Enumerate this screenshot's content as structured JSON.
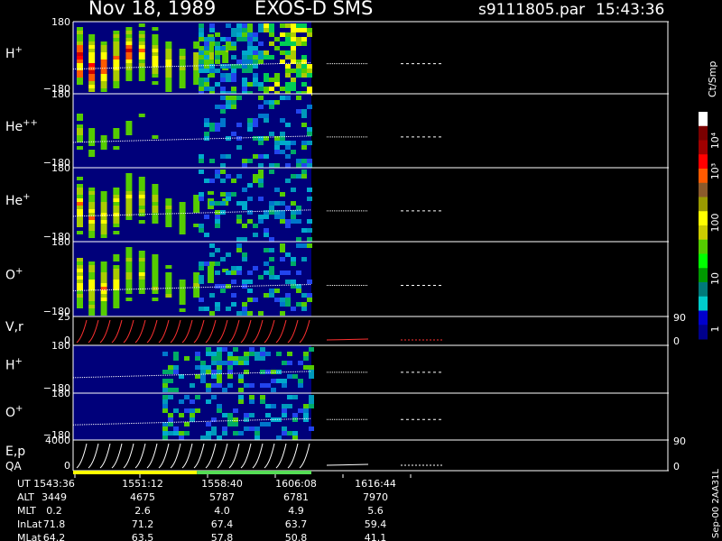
{
  "header": {
    "date": "Nov 18, 1989",
    "instrument": "EXOS-D SMS",
    "file": "s9111805.par",
    "time": "15:43:36"
  },
  "colorbar": {
    "title": "Ct/Smp",
    "ticks": [
      "10⁴",
      "10³",
      "100",
      "10",
      "1"
    ],
    "colors": [
      "#ffffff",
      "#7a0000",
      "#a00000",
      "#ff0000",
      "#ff5a00",
      "#8b5a2b",
      "#9a9a00",
      "#ffff00",
      "#cccc00",
      "#55cc00",
      "#00ff00",
      "#009900",
      "#007a7a",
      "#00cccc",
      "#0000cc",
      "#00008b"
    ]
  },
  "chart_data": {
    "type": "heatmap",
    "x_axis": {
      "rows": [
        {
          "label": "UT",
          "values": [
            "1543:36",
            "1551:12",
            "1558:40",
            "1606:08",
            "1616:44"
          ]
        },
        {
          "label": "ALT",
          "values": [
            "3449",
            "4675",
            "5787",
            "6781",
            "7970"
          ]
        },
        {
          "label": "MLT",
          "values": [
            "0.2",
            "2.6",
            "4.0",
            "4.9",
            "5.6"
          ]
        },
        {
          "label": "InLat",
          "values": [
            "71.8",
            "71.2",
            "67.4",
            "63.7",
            "59.4"
          ]
        },
        {
          "label": "MLat",
          "values": [
            "64.2",
            "63.5",
            "57.8",
            "50.8",
            "41.1"
          ]
        }
      ]
    },
    "panels": [
      {
        "label": "H",
        "sup": "+",
        "ymax": "180",
        "ymin": "−180",
        "style": "spectrogram-strong"
      },
      {
        "label": "He",
        "sup": "++",
        "ymax": "180",
        "ymin": "−180",
        "style": "spectrogram-weak"
      },
      {
        "label": "He",
        "sup": "+",
        "ymax": "180",
        "ymin": "−180",
        "style": "spectrogram-medium"
      },
      {
        "label": "O",
        "sup": "+",
        "ymax": "180",
        "ymin": "−180",
        "style": "spectrogram-medium"
      },
      {
        "label": "V,r",
        "sup": "",
        "ymax": "25",
        "ymin": "0",
        "right_top": "90",
        "right_bottom": "0",
        "style": "line-red"
      },
      {
        "label": "H",
        "sup": "+",
        "ymax": "180",
        "ymin": "−180",
        "style": "spectrogram-low"
      },
      {
        "label": "O",
        "sup": "+",
        "ymax": "180",
        "ymin": "−180",
        "style": "spectrogram-low"
      },
      {
        "label": "E,p",
        "sup": "",
        "label2": "QA",
        "ymax": "4000",
        "ymin": "0",
        "right_top": "90",
        "right_bottom": "0",
        "style": "line-white"
      }
    ],
    "qa_bar": [
      {
        "color": "#ffff00",
        "fraction": 0.52
      },
      {
        "color": "#55dd55",
        "fraction": 0.48
      }
    ]
  },
  "footer": {
    "side_note": "Sep-00 2AA31L"
  }
}
